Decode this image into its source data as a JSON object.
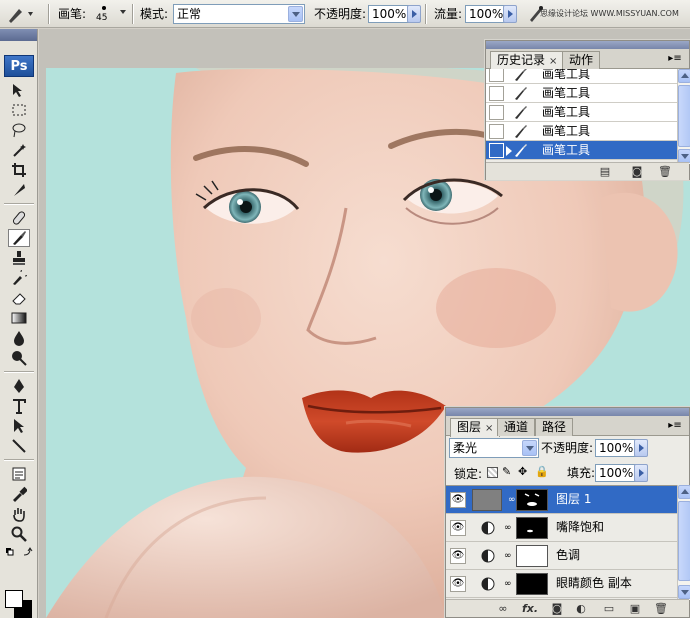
{
  "options_bar": {
    "brush_label": "画笔:",
    "brush_size": "45",
    "mode_label": "模式:",
    "mode_value": "正常",
    "opacity_label": "不透明度:",
    "opacity_value": "100%",
    "flow_label": "流量:",
    "flow_value": "100%",
    "watermark": "思缘设计论坛 WWW.MISSYUAN.COM"
  },
  "toolbox": {
    "logo": "Ps"
  },
  "history_panel": {
    "tabs": [
      {
        "label": "历史记录",
        "close": "×"
      },
      {
        "label": "动作"
      }
    ],
    "menu": "▸≡",
    "items": [
      {
        "label": "画笔工具"
      },
      {
        "label": "画笔工具"
      },
      {
        "label": "画笔工具"
      },
      {
        "label": "画笔工具"
      },
      {
        "label": "画笔工具",
        "selected": true
      }
    ]
  },
  "layers_panel": {
    "tabs": [
      {
        "label": "图层",
        "close": "×"
      },
      {
        "label": "通道"
      },
      {
        "label": "路径"
      }
    ],
    "menu": "▸≡",
    "blend_mode": "柔光",
    "opacity_label": "不透明度:",
    "opacity_value": "100%",
    "lock_label": "锁定:",
    "fill_label": "填充:",
    "fill_value": "100%",
    "layers": [
      {
        "name": "图层 1",
        "selected": true
      },
      {
        "name": "嘴降饱和"
      },
      {
        "name": "色调"
      },
      {
        "name": "眼睛颜色 副本"
      }
    ],
    "footer_fx": "fx."
  },
  "colors": {
    "canvas_bg": "#b4e2dc",
    "selection": "#316ac5",
    "lips": "#c0391f"
  }
}
